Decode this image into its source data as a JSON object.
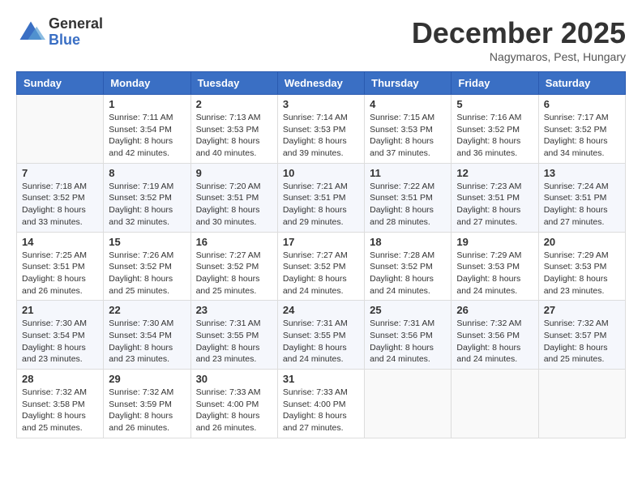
{
  "logo": {
    "general": "General",
    "blue": "Blue"
  },
  "title": "December 2025",
  "location": "Nagymaros, Pest, Hungary",
  "days_of_week": [
    "Sunday",
    "Monday",
    "Tuesday",
    "Wednesday",
    "Thursday",
    "Friday",
    "Saturday"
  ],
  "weeks": [
    [
      {
        "day": "",
        "sunrise": "",
        "sunset": "",
        "daylight": ""
      },
      {
        "day": "1",
        "sunrise": "Sunrise: 7:11 AM",
        "sunset": "Sunset: 3:54 PM",
        "daylight": "Daylight: 8 hours and 42 minutes."
      },
      {
        "day": "2",
        "sunrise": "Sunrise: 7:13 AM",
        "sunset": "Sunset: 3:53 PM",
        "daylight": "Daylight: 8 hours and 40 minutes."
      },
      {
        "day": "3",
        "sunrise": "Sunrise: 7:14 AM",
        "sunset": "Sunset: 3:53 PM",
        "daylight": "Daylight: 8 hours and 39 minutes."
      },
      {
        "day": "4",
        "sunrise": "Sunrise: 7:15 AM",
        "sunset": "Sunset: 3:53 PM",
        "daylight": "Daylight: 8 hours and 37 minutes."
      },
      {
        "day": "5",
        "sunrise": "Sunrise: 7:16 AM",
        "sunset": "Sunset: 3:52 PM",
        "daylight": "Daylight: 8 hours and 36 minutes."
      },
      {
        "day": "6",
        "sunrise": "Sunrise: 7:17 AM",
        "sunset": "Sunset: 3:52 PM",
        "daylight": "Daylight: 8 hours and 34 minutes."
      }
    ],
    [
      {
        "day": "7",
        "sunrise": "Sunrise: 7:18 AM",
        "sunset": "Sunset: 3:52 PM",
        "daylight": "Daylight: 8 hours and 33 minutes."
      },
      {
        "day": "8",
        "sunrise": "Sunrise: 7:19 AM",
        "sunset": "Sunset: 3:52 PM",
        "daylight": "Daylight: 8 hours and 32 minutes."
      },
      {
        "day": "9",
        "sunrise": "Sunrise: 7:20 AM",
        "sunset": "Sunset: 3:51 PM",
        "daylight": "Daylight: 8 hours and 30 minutes."
      },
      {
        "day": "10",
        "sunrise": "Sunrise: 7:21 AM",
        "sunset": "Sunset: 3:51 PM",
        "daylight": "Daylight: 8 hours and 29 minutes."
      },
      {
        "day": "11",
        "sunrise": "Sunrise: 7:22 AM",
        "sunset": "Sunset: 3:51 PM",
        "daylight": "Daylight: 8 hours and 28 minutes."
      },
      {
        "day": "12",
        "sunrise": "Sunrise: 7:23 AM",
        "sunset": "Sunset: 3:51 PM",
        "daylight": "Daylight: 8 hours and 27 minutes."
      },
      {
        "day": "13",
        "sunrise": "Sunrise: 7:24 AM",
        "sunset": "Sunset: 3:51 PM",
        "daylight": "Daylight: 8 hours and 27 minutes."
      }
    ],
    [
      {
        "day": "14",
        "sunrise": "Sunrise: 7:25 AM",
        "sunset": "Sunset: 3:51 PM",
        "daylight": "Daylight: 8 hours and 26 minutes."
      },
      {
        "day": "15",
        "sunrise": "Sunrise: 7:26 AM",
        "sunset": "Sunset: 3:52 PM",
        "daylight": "Daylight: 8 hours and 25 minutes."
      },
      {
        "day": "16",
        "sunrise": "Sunrise: 7:27 AM",
        "sunset": "Sunset: 3:52 PM",
        "daylight": "Daylight: 8 hours and 25 minutes."
      },
      {
        "day": "17",
        "sunrise": "Sunrise: 7:27 AM",
        "sunset": "Sunset: 3:52 PM",
        "daylight": "Daylight: 8 hours and 24 minutes."
      },
      {
        "day": "18",
        "sunrise": "Sunrise: 7:28 AM",
        "sunset": "Sunset: 3:52 PM",
        "daylight": "Daylight: 8 hours and 24 minutes."
      },
      {
        "day": "19",
        "sunrise": "Sunrise: 7:29 AM",
        "sunset": "Sunset: 3:53 PM",
        "daylight": "Daylight: 8 hours and 24 minutes."
      },
      {
        "day": "20",
        "sunrise": "Sunrise: 7:29 AM",
        "sunset": "Sunset: 3:53 PM",
        "daylight": "Daylight: 8 hours and 23 minutes."
      }
    ],
    [
      {
        "day": "21",
        "sunrise": "Sunrise: 7:30 AM",
        "sunset": "Sunset: 3:54 PM",
        "daylight": "Daylight: 8 hours and 23 minutes."
      },
      {
        "day": "22",
        "sunrise": "Sunrise: 7:30 AM",
        "sunset": "Sunset: 3:54 PM",
        "daylight": "Daylight: 8 hours and 23 minutes."
      },
      {
        "day": "23",
        "sunrise": "Sunrise: 7:31 AM",
        "sunset": "Sunset: 3:55 PM",
        "daylight": "Daylight: 8 hours and 23 minutes."
      },
      {
        "day": "24",
        "sunrise": "Sunrise: 7:31 AM",
        "sunset": "Sunset: 3:55 PM",
        "daylight": "Daylight: 8 hours and 24 minutes."
      },
      {
        "day": "25",
        "sunrise": "Sunrise: 7:31 AM",
        "sunset": "Sunset: 3:56 PM",
        "daylight": "Daylight: 8 hours and 24 minutes."
      },
      {
        "day": "26",
        "sunrise": "Sunrise: 7:32 AM",
        "sunset": "Sunset: 3:56 PM",
        "daylight": "Daylight: 8 hours and 24 minutes."
      },
      {
        "day": "27",
        "sunrise": "Sunrise: 7:32 AM",
        "sunset": "Sunset: 3:57 PM",
        "daylight": "Daylight: 8 hours and 25 minutes."
      }
    ],
    [
      {
        "day": "28",
        "sunrise": "Sunrise: 7:32 AM",
        "sunset": "Sunset: 3:58 PM",
        "daylight": "Daylight: 8 hours and 25 minutes."
      },
      {
        "day": "29",
        "sunrise": "Sunrise: 7:32 AM",
        "sunset": "Sunset: 3:59 PM",
        "daylight": "Daylight: 8 hours and 26 minutes."
      },
      {
        "day": "30",
        "sunrise": "Sunrise: 7:33 AM",
        "sunset": "Sunset: 4:00 PM",
        "daylight": "Daylight: 8 hours and 26 minutes."
      },
      {
        "day": "31",
        "sunrise": "Sunrise: 7:33 AM",
        "sunset": "Sunset: 4:00 PM",
        "daylight": "Daylight: 8 hours and 27 minutes."
      },
      {
        "day": "",
        "sunrise": "",
        "sunset": "",
        "daylight": ""
      },
      {
        "day": "",
        "sunrise": "",
        "sunset": "",
        "daylight": ""
      },
      {
        "day": "",
        "sunrise": "",
        "sunset": "",
        "daylight": ""
      }
    ]
  ]
}
